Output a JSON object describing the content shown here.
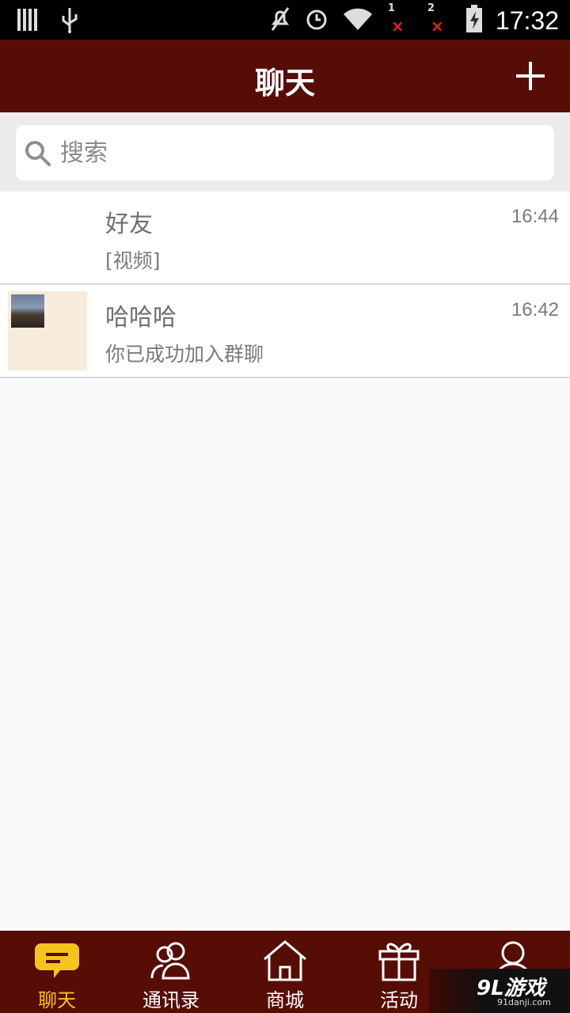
{
  "status_bar": {
    "time": "17:32",
    "sim1": "1",
    "sim2": "2",
    "no_signal": "×"
  },
  "header": {
    "title": "聊天"
  },
  "search": {
    "placeholder": "搜索"
  },
  "chats": [
    {
      "name": "好友",
      "message": "[视频]",
      "time": "16:44"
    },
    {
      "name": "哈哈哈",
      "message": "你已成功加入群聊",
      "time": "16:42"
    }
  ],
  "bottom_nav": {
    "items": [
      {
        "label": "聊天",
        "icon": "chat-bubble-icon",
        "active": true
      },
      {
        "label": "通讯录",
        "icon": "contacts-icon"
      },
      {
        "label": "商城",
        "icon": "home-store-icon"
      },
      {
        "label": "活动",
        "icon": "gift-icon"
      },
      {
        "label": "",
        "icon": "profile-icon"
      }
    ]
  },
  "watermark": {
    "brand": "9L游戏",
    "site": "91danji.com"
  },
  "colors": {
    "brand_dark_red": "#560d06",
    "active_yellow": "#f6c51b"
  }
}
